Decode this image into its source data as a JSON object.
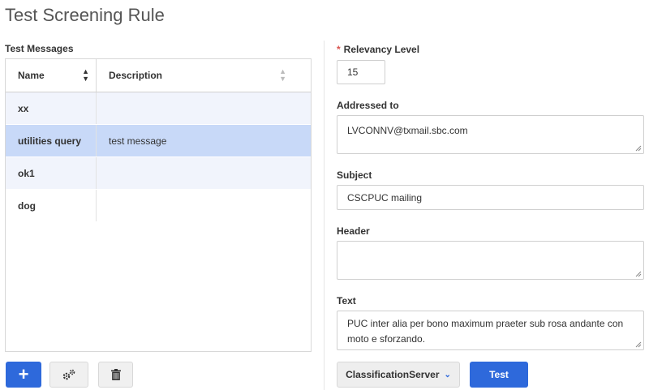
{
  "page": {
    "title": "Test Screening Rule"
  },
  "messages": {
    "section_label": "Test Messages",
    "columns": {
      "name": "Name",
      "description": "Description"
    },
    "rows": [
      {
        "name": "xx",
        "description": ""
      },
      {
        "name": "utilities query",
        "description": "test message"
      },
      {
        "name": "ok1",
        "description": ""
      },
      {
        "name": "dog",
        "description": ""
      }
    ],
    "selected_row": "utilities query"
  },
  "toolbar": {
    "add_icon": "plus-icon",
    "edit_icon": "gears-icon",
    "delete_icon": "trash-icon"
  },
  "form": {
    "relevancy": {
      "label": "Relevancy Level",
      "value": "15",
      "required": true
    },
    "addressed_to": {
      "label": "Addressed to",
      "value": "LVCONNV@txmail.sbc.com"
    },
    "subject": {
      "label": "Subject",
      "value": "CSCPUC mailing"
    },
    "header": {
      "label": "Header",
      "value": ""
    },
    "text": {
      "label": "Text",
      "value": "PUC inter alia per bono maximum praeter sub rosa andante con moto e sforzando."
    }
  },
  "actions": {
    "server_select": "ClassificationServer",
    "test_button": "Test"
  },
  "colors": {
    "accent": "#2e69db",
    "selected_row": "#c8d9f8",
    "required": "#d9534f"
  }
}
